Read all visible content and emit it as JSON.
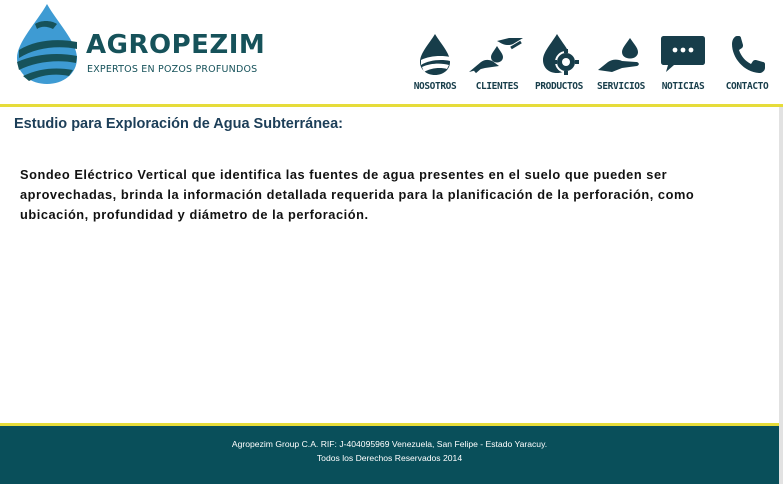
{
  "header": {
    "brand_name": "AGROPEZIM",
    "brand_tagline": "EXPERTOS EN POZOS PROFUNDOS",
    "brand_color": "#16525a",
    "accent_color": "#e6dc3a",
    "nav": [
      {
        "label": "NOSOTROS",
        "icon": "water-drop-icon"
      },
      {
        "label": "CLIENTES",
        "icon": "hands-drop-icon"
      },
      {
        "label": "PRODUCTOS",
        "icon": "drop-gear-icon"
      },
      {
        "label": "SERVICIOS",
        "icon": "hand-drop-icon"
      },
      {
        "label": "NOTICIAS",
        "icon": "chat-bubble-icon"
      },
      {
        "label": "CONTACTO",
        "icon": "phone-icon"
      }
    ]
  },
  "main": {
    "title": "Estudio para Exploración de Agua Subterránea:",
    "description": "Sondeo Eléctrico Vertical que identifica las fuentes de agua presentes en el suelo que pueden ser aprovechadas, brinda la información detallada requerida para la planificación de la perforación, como ubicación, profundidad y diámetro de la perforación."
  },
  "footer": {
    "line1": "Agropezim Group C.A. RIF: J-404095969 Venezuela, San Felipe - Estado Yaracuy.",
    "line2": "Todos los Derechos Reservados 2014",
    "background": "#094f5a"
  }
}
